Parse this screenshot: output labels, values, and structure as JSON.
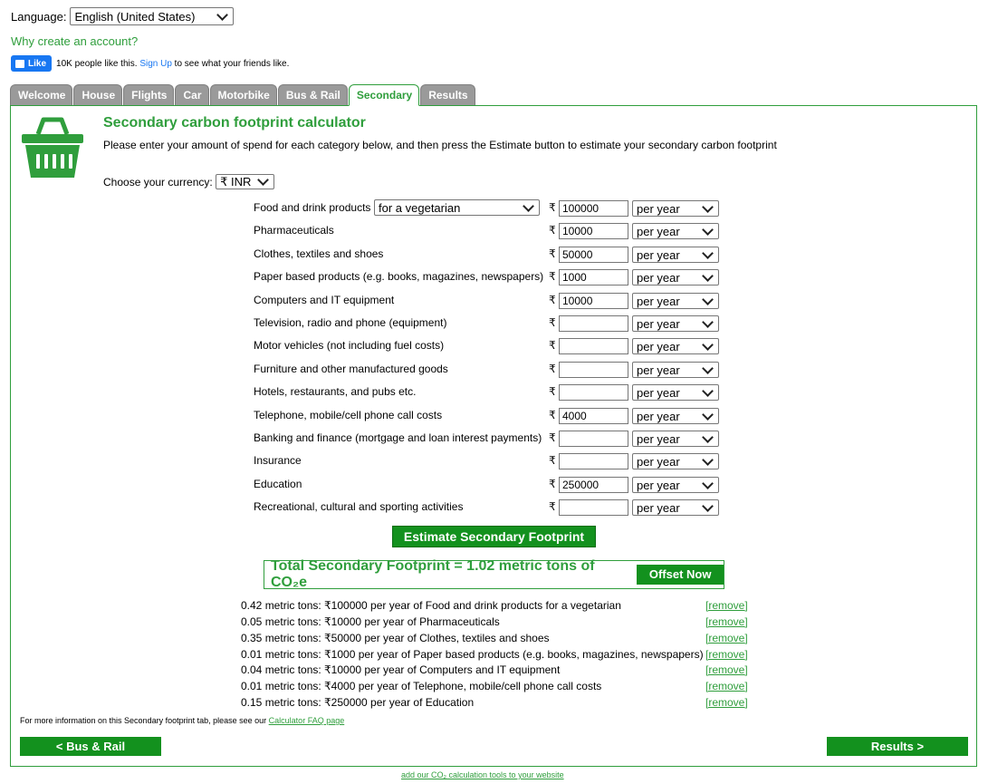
{
  "language": {
    "label": "Language:",
    "value": "English (United States)"
  },
  "account_link": "Why create an account?",
  "facebook": {
    "like_label": "Like",
    "count_text": "10K people like this.",
    "signup_link": "Sign Up",
    "suffix_text": "to see what your friends like."
  },
  "tabs": [
    "Welcome",
    "House",
    "Flights",
    "Car",
    "Motorbike",
    "Bus & Rail",
    "Secondary",
    "Results"
  ],
  "active_tab": "Secondary",
  "calculator": {
    "title": "Secondary carbon footprint calculator",
    "intro": "Please enter your amount of spend for each category below, and then press the Estimate button to estimate your secondary carbon footprint",
    "currency_label": "Choose your currency:",
    "currency_value": "₹ INR",
    "currency_symbol": "₹",
    "food_type": "for a vegetarian",
    "rows": [
      {
        "label": "Food and drink products",
        "amount": "100000",
        "period": "per year"
      },
      {
        "label": "Pharmaceuticals",
        "amount": "10000",
        "period": "per year"
      },
      {
        "label": "Clothes, textiles and shoes",
        "amount": "50000",
        "period": "per year"
      },
      {
        "label": "Paper based products (e.g. books, magazines, newspapers)",
        "amount": "1000",
        "period": "per year"
      },
      {
        "label": "Computers and IT equipment",
        "amount": "10000",
        "period": "per year"
      },
      {
        "label": "Television, radio and phone (equipment)",
        "amount": "",
        "period": "per year"
      },
      {
        "label": "Motor vehicles (not including fuel costs)",
        "amount": "",
        "period": "per year"
      },
      {
        "label": "Furniture and other manufactured goods",
        "amount": "",
        "period": "per year"
      },
      {
        "label": "Hotels, restaurants, and pubs etc.",
        "amount": "",
        "period": "per year"
      },
      {
        "label": "Telephone, mobile/cell phone call costs",
        "amount": "4000",
        "period": "per year"
      },
      {
        "label": "Banking and finance (mortgage and loan interest payments)",
        "amount": "",
        "period": "per year"
      },
      {
        "label": "Insurance",
        "amount": "",
        "period": "per year"
      },
      {
        "label": "Education",
        "amount": "250000",
        "period": "per year"
      },
      {
        "label": "Recreational, cultural and sporting activities",
        "amount": "",
        "period": "per year"
      }
    ],
    "estimate_button": "Estimate Secondary Footprint",
    "total_text": "Total Secondary Footprint = 1.02 metric tons of CO₂e",
    "offset_button": "Offset Now",
    "results": [
      "0.42 metric tons: ₹100000 per year of Food and drink products for a vegetarian",
      "0.05 metric tons: ₹10000 per year of Pharmaceuticals",
      "0.35 metric tons: ₹50000 per year of Clothes, textiles and shoes",
      "0.01 metric tons: ₹1000 per year of Paper based products (e.g. books, magazines, newspapers)",
      "0.04 metric tons: ₹10000 per year of Computers and IT equipment",
      "0.01 metric tons: ₹4000 per year of Telephone, mobile/cell phone call costs",
      "0.15 metric tons: ₹250000 per year of Education"
    ],
    "remove_label": "[remove]",
    "faq_text": "For more information on this Secondary footprint tab, please see our",
    "faq_link": "Calculator FAQ page"
  },
  "nav": {
    "prev": "< Bus & Rail",
    "next": "Results >"
  },
  "footer_link": "add our CO₂ calculation tools to your website",
  "colors": {
    "brand_green": "#2f9e3c",
    "button_green": "#13911e",
    "tab_gray": "#9a9a9a",
    "facebook_blue": "#1877f2"
  },
  "icons": {
    "category": "shopping-basket-icon"
  }
}
